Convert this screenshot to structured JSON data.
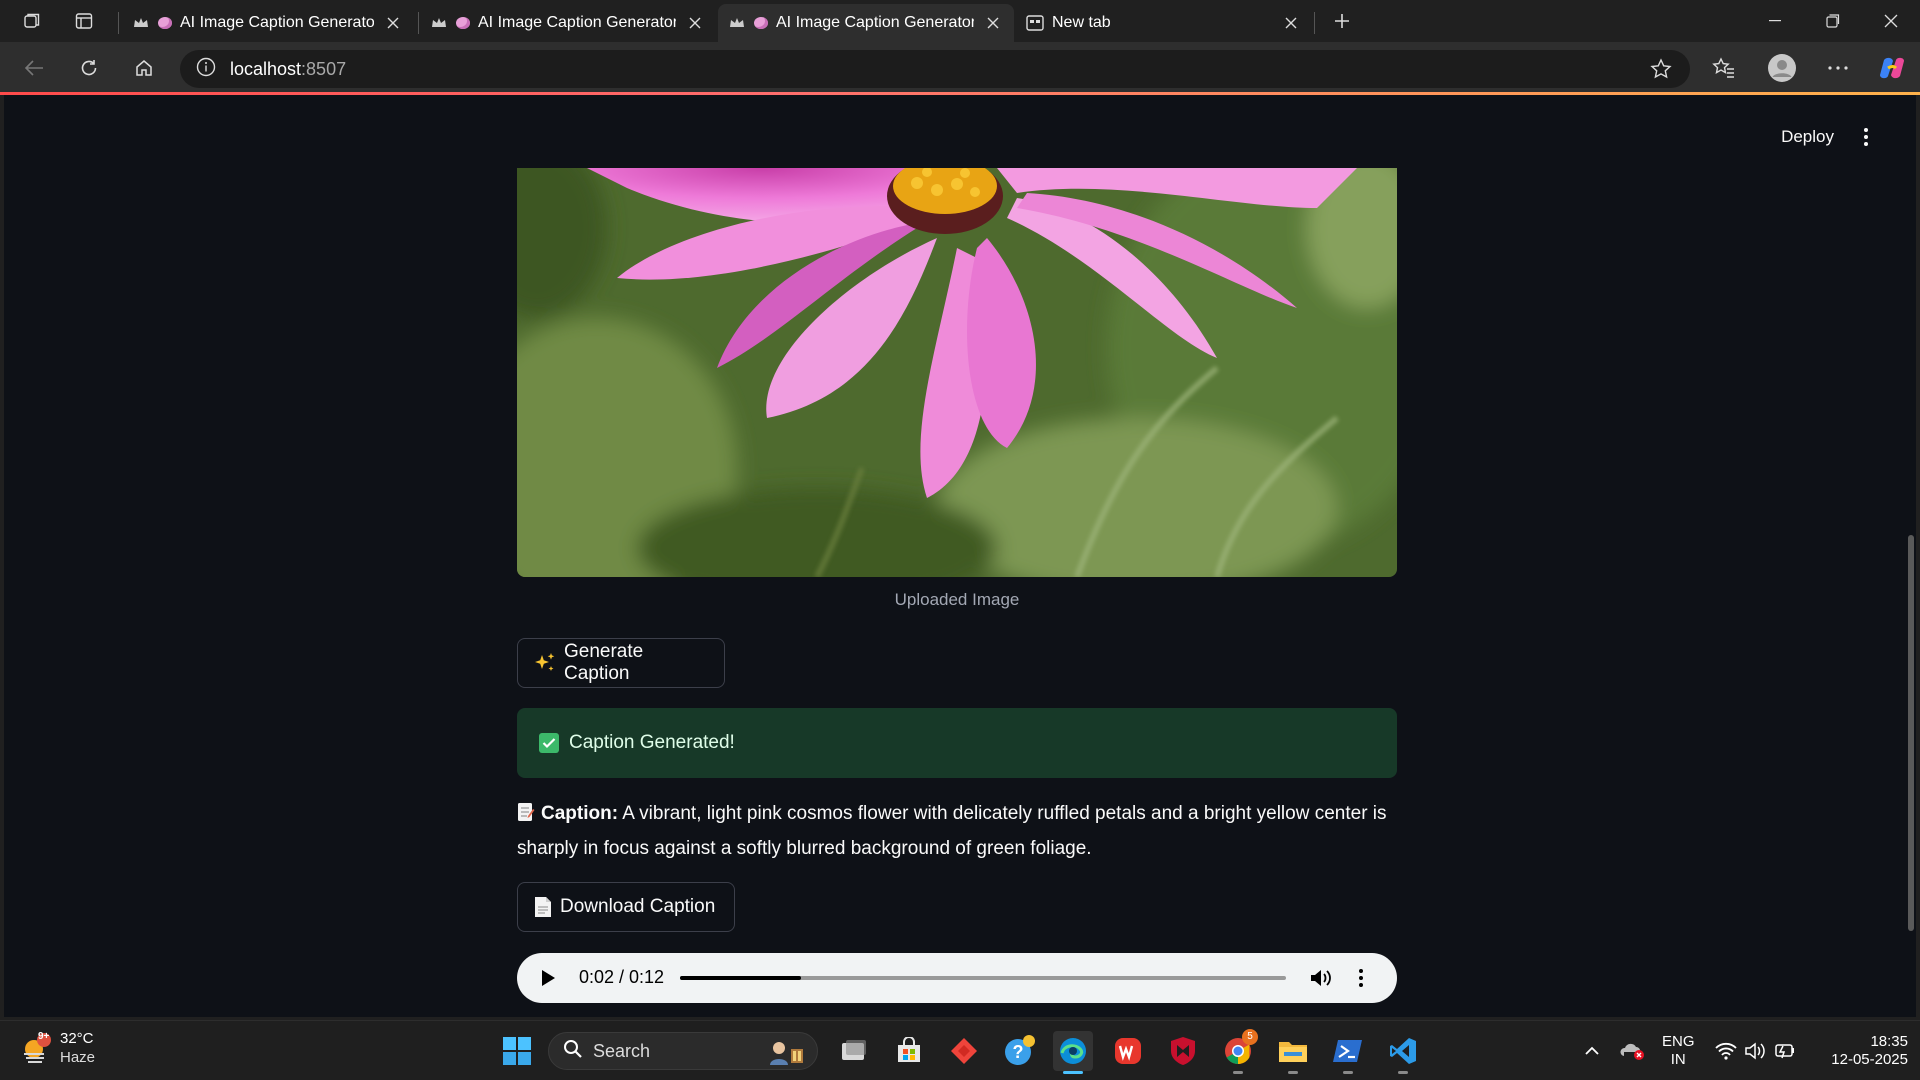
{
  "browser": {
    "tabs": [
      {
        "title": "AI Image Caption Generator",
        "active": false
      },
      {
        "title": "AI Image Caption Generator",
        "active": false
      },
      {
        "title": "AI Image Caption Generator",
        "active": true
      },
      {
        "title": "New tab",
        "active": false
      }
    ],
    "address": {
      "host": "localhost",
      "port": ":8507"
    }
  },
  "app": {
    "deploy_label": "Deploy",
    "image_caption": "Uploaded Image",
    "generate_button": "Generate Caption",
    "generate_emoji": "sparkles-icon",
    "success_message": "Caption Generated!",
    "caption_label": "Caption:",
    "caption_text": "A vibrant, light pink cosmos flower with delicately ruffled petals and a bright yellow center is sharply in focus against a softly blurred background of green foliage.",
    "download_button": "Download Caption",
    "audio": {
      "time": "0:02 / 0:12",
      "progress": 0.2
    }
  },
  "colors": {
    "page_bg": "#0e1117",
    "success_bg": "#173928",
    "accent_red": "#ff4b4b"
  },
  "taskbar": {
    "weather": {
      "temp": "32°C",
      "condition": "Haze",
      "badge": "9+"
    },
    "search_label": "Search",
    "chrome_badge": "5",
    "lang": {
      "line1": "ENG",
      "line2": "IN"
    },
    "clock": {
      "time": "18:35",
      "date": "12-05-2025"
    }
  }
}
